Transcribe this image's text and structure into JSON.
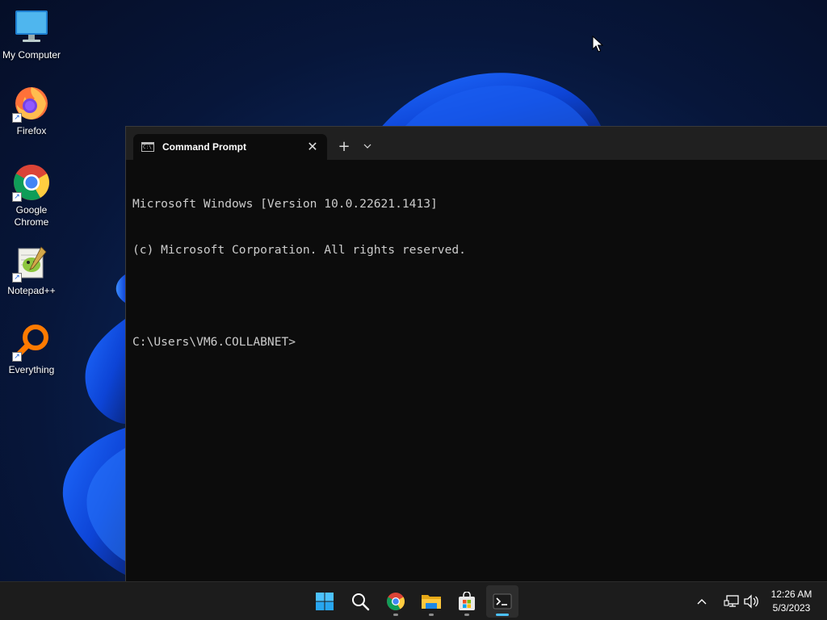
{
  "desktop": {
    "icons": [
      {
        "label": "My Computer",
        "icon": "monitor-icon"
      },
      {
        "label": "Firefox",
        "icon": "firefox-icon"
      },
      {
        "label": "Google Chrome",
        "icon": "chrome-icon"
      },
      {
        "label": "Notepad++",
        "icon": "notepadpp-icon"
      },
      {
        "label": "Everything",
        "icon": "everything-icon"
      }
    ]
  },
  "terminal": {
    "tab_title": "Command Prompt",
    "tab_icon_text": "C:\\",
    "close_symbol": "✕",
    "new_tab_symbol": "+",
    "lines": [
      "Microsoft Windows [Version 10.0.22621.1413]",
      "(c) Microsoft Corporation. All rights reserved.",
      "",
      "C:\\Users\\VM6.COLLABNET>"
    ]
  },
  "taskbar": {
    "apps": [
      {
        "name": "start",
        "icon": "windows-start-icon",
        "running": false
      },
      {
        "name": "search",
        "icon": "search-icon",
        "running": false
      },
      {
        "name": "chrome",
        "icon": "chrome-icon",
        "running": true
      },
      {
        "name": "file-explorer",
        "icon": "folder-icon",
        "running": true
      },
      {
        "name": "store",
        "icon": "store-icon",
        "running": true
      },
      {
        "name": "terminal",
        "icon": "terminal-icon",
        "running": true,
        "active": true
      }
    ],
    "clock": {
      "time": "12:26 AM",
      "date": "5/3/2023"
    }
  },
  "colors": {
    "terminal_bg": "#0c0c0c",
    "titlebar_bg": "#202020",
    "taskbar_bg": "#1c1c1c",
    "accent": "#4cc2ff"
  }
}
